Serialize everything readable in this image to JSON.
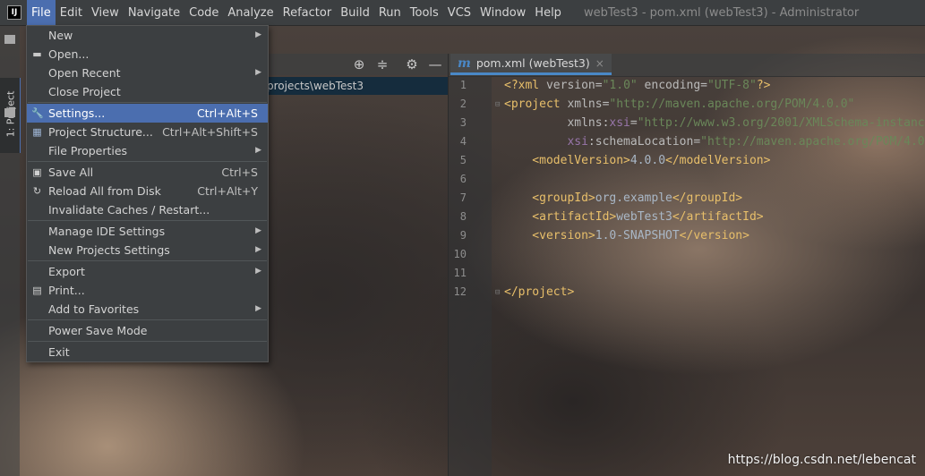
{
  "window": {
    "logo_text": "IJ",
    "title": "webTest3 - pom.xml (webTest3) - Administrator"
  },
  "menubar": {
    "items": [
      "File",
      "Edit",
      "View",
      "Navigate",
      "Code",
      "Analyze",
      "Refactor",
      "Build",
      "Run",
      "Tools",
      "VCS",
      "Window",
      "Help"
    ],
    "active": "File"
  },
  "tool_stripe": {
    "project_tab": "1: Project"
  },
  "project_panel": {
    "path_text": "projects\\webTest3",
    "icons": [
      "crosshair-icon",
      "collapse-icon",
      "gear-icon",
      "minimize-icon"
    ]
  },
  "editor": {
    "tab_icon_letter": "m",
    "tab_label": "pom.xml (webTest3)",
    "tab_close": "×",
    "line_numbers": [
      "1",
      "2",
      "3",
      "4",
      "5",
      "6",
      "7",
      "8",
      "9",
      "10",
      "11",
      "12"
    ]
  },
  "file_menu": {
    "items": [
      {
        "label": "New",
        "shortcut": "",
        "submenu": true,
        "icon": ""
      },
      {
        "label": "Open...",
        "shortcut": "",
        "submenu": false,
        "icon": "folder-open-icon"
      },
      {
        "label": "Open Recent",
        "shortcut": "",
        "submenu": true,
        "icon": ""
      },
      {
        "label": "Close Project",
        "shortcut": "",
        "submenu": false,
        "icon": ""
      },
      {
        "label": "Settings...",
        "shortcut": "Ctrl+Alt+S",
        "submenu": false,
        "icon": "wrench-icon",
        "selected": true
      },
      {
        "label": "Project Structure...",
        "shortcut": "Ctrl+Alt+Shift+S",
        "submenu": false,
        "icon": "project-structure-icon"
      },
      {
        "label": "File Properties",
        "shortcut": "",
        "submenu": true,
        "icon": ""
      },
      {
        "label": "Save All",
        "shortcut": "Ctrl+S",
        "submenu": false,
        "icon": "save-icon"
      },
      {
        "label": "Reload All from Disk",
        "shortcut": "Ctrl+Alt+Y",
        "submenu": false,
        "icon": "reload-icon"
      },
      {
        "label": "Invalidate Caches / Restart...",
        "shortcut": "",
        "submenu": false,
        "icon": ""
      },
      {
        "label": "Manage IDE Settings",
        "shortcut": "",
        "submenu": true,
        "icon": ""
      },
      {
        "label": "New Projects Settings",
        "shortcut": "",
        "submenu": true,
        "icon": ""
      },
      {
        "label": "Export",
        "shortcut": "",
        "submenu": true,
        "icon": ""
      },
      {
        "label": "Print...",
        "shortcut": "",
        "submenu": false,
        "icon": "print-icon"
      },
      {
        "label": "Add to Favorites",
        "shortcut": "",
        "submenu": true,
        "icon": ""
      },
      {
        "label": "Power Save Mode",
        "shortcut": "",
        "submenu": false,
        "icon": ""
      },
      {
        "label": "Exit",
        "shortcut": "",
        "submenu": false,
        "icon": ""
      }
    ]
  },
  "watermark": "https://blog.csdn.net/lebencat",
  "colors": {
    "menu_bg": "#3c3f41",
    "selection": "#4b6eaf",
    "xml_tag": "#e8bf6a",
    "xml_string": "#6a8759",
    "xml_namespace": "#9876aa",
    "text": "#a9b7c6"
  }
}
